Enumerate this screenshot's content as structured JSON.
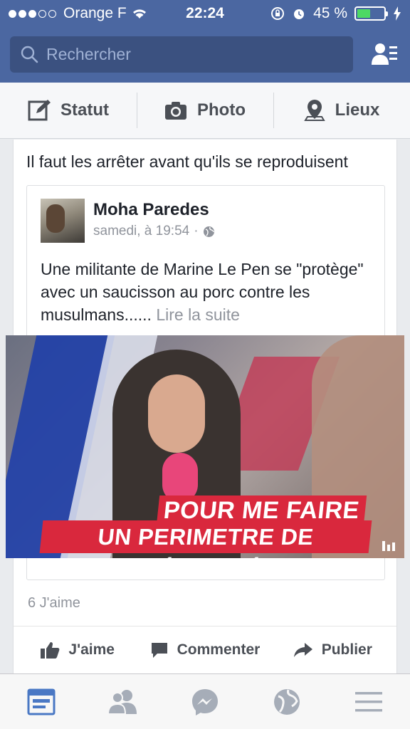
{
  "status_bar": {
    "carrier": "Orange F",
    "time": "22:24",
    "battery": "45 %",
    "battery_level": 0.45
  },
  "search": {
    "placeholder": "Rechercher"
  },
  "composer": {
    "status_label": "Statut",
    "photo_label": "Photo",
    "places_label": "Lieux"
  },
  "post": {
    "text": "Il faut les arrêter avant qu'ils se reproduisent",
    "shared": {
      "author": "Moha Paredes",
      "timestamp": "samedi, à 19:54",
      "separator": "·",
      "text": "Une militante de Marine Le Pen se \"protège\" avec un saucisson au porc contre les musulmans......",
      "read_more": "Lire la suite",
      "video_caption_line1": "POUR ME FAIRE",
      "video_caption_line2": "UN PERIMETRE DE SÉCURITÉ"
    },
    "likes": "6 J'aime",
    "actions": {
      "like": "J'aime",
      "comment": "Commenter",
      "share": "Publier"
    }
  },
  "colors": {
    "brand_blue": "#4b67a1",
    "search_bg": "#3b5180",
    "active_tab": "#4a78c4",
    "inactive_tab": "#a6adb8"
  },
  "tabbar": {
    "tabs": [
      "news-feed-icon",
      "friend-requests-icon",
      "messenger-icon",
      "notifications-globe-icon",
      "menu-icon"
    ],
    "active": "news-feed-icon"
  }
}
